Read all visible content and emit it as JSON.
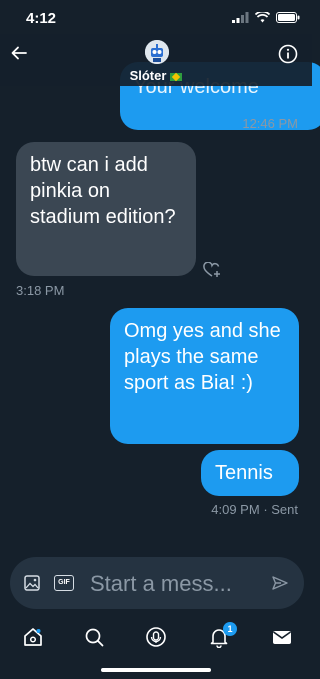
{
  "status": {
    "time": "4:12"
  },
  "header": {
    "name": "Slóter"
  },
  "messages": [
    {
      "id": "prev",
      "text": "Your welcome",
      "time": "12:46 PM",
      "direction": "out"
    },
    {
      "id": "m1",
      "text": "btw can i add pinkia on stadium edition?",
      "time": "3:18 PM",
      "direction": "in"
    },
    {
      "id": "m2",
      "text": "Omg yes and she plays the same sport as Bia! :)",
      "direction": "out"
    },
    {
      "id": "m3",
      "text": "Tennis",
      "time": "4:09 PM",
      "status": "· Sent",
      "direction": "out"
    }
  ],
  "composer": {
    "placeholder": "Start a mess...",
    "gif_label": "GIF"
  },
  "tabbar": {
    "notifications_badge": "1"
  },
  "colors": {
    "background": "#15202b",
    "accent": "#1d9bf0",
    "incoming_bubble": "#3b4753",
    "muted_text": "#8b98a5"
  },
  "icons": [
    "back-arrow-icon",
    "info-icon",
    "image-icon",
    "gif-icon",
    "send-icon",
    "home-icon",
    "search-icon",
    "spaces-icon",
    "bell-icon",
    "mail-icon",
    "heart-plus-icon"
  ]
}
